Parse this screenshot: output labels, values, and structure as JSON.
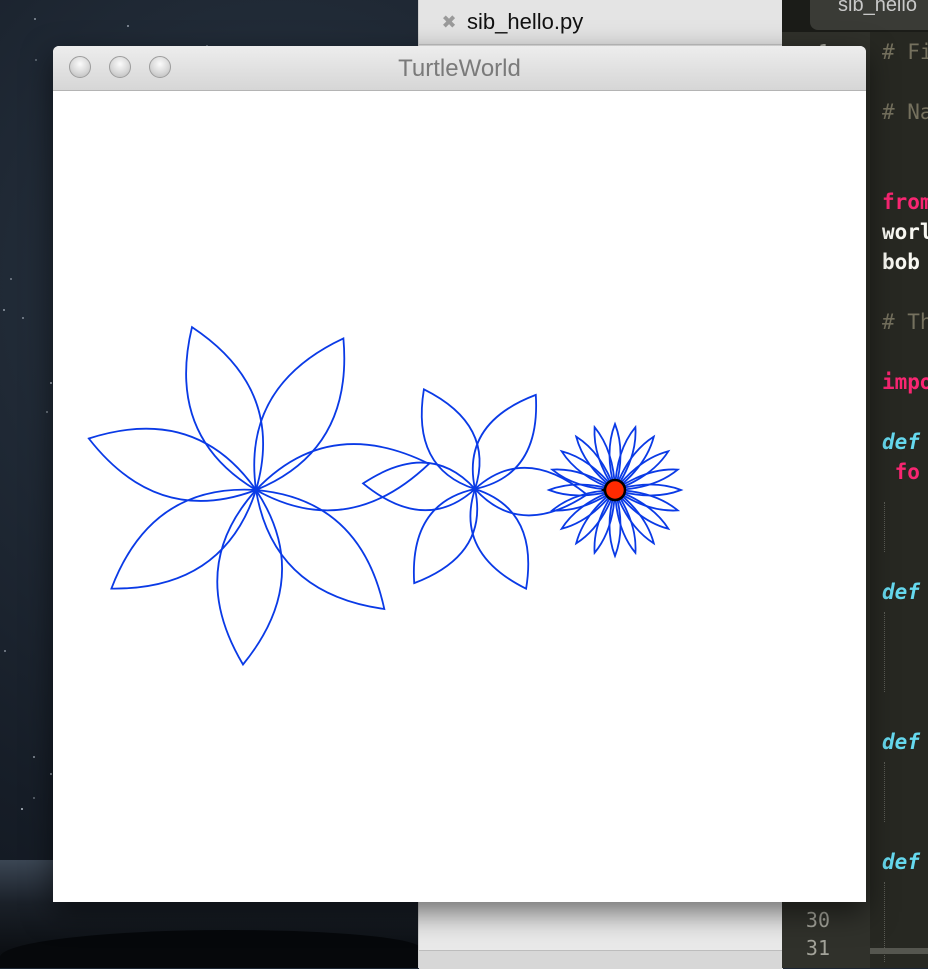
{
  "window": {
    "title": "TurtleWorld"
  },
  "background_tab": {
    "label": "sib_hello.py",
    "close_glyph": "✖"
  },
  "editor": {
    "top_tab_label": "sib_hello",
    "line_numbers": [
      "1",
      "30",
      "31"
    ],
    "code_lines": [
      {
        "text": "# Fi",
        "kind": "comment"
      },
      {
        "text": "# Na",
        "kind": "comment"
      },
      {
        "text": "from",
        "kind": "kw"
      },
      {
        "text": "worl",
        "kind": "plain"
      },
      {
        "text": "bob",
        "kind": "plain"
      },
      {
        "text": "# Th",
        "kind": "comment"
      },
      {
        "text": "impo",
        "kind": "kw"
      },
      {
        "text": "def",
        "kind": "def"
      },
      {
        "text": " fo",
        "kind": "kw"
      },
      {
        "text": "def",
        "kind": "def"
      },
      {
        "text": "def",
        "kind": "def"
      },
      {
        "text": "def",
        "kind": "def"
      }
    ]
  },
  "canvas": {
    "stroke_color": "#0a3ae6",
    "turtle_color": "#ff2a00",
    "flowers": [
      {
        "name": "large-flower",
        "petals": 7
      },
      {
        "name": "medium-flower",
        "petals": 6
      },
      {
        "name": "small-flower",
        "petals": 20
      }
    ]
  },
  "icons": {
    "close": "close-icon",
    "minimize": "minimize-icon",
    "zoom": "zoom-icon",
    "turtle": "turtle-icon"
  }
}
